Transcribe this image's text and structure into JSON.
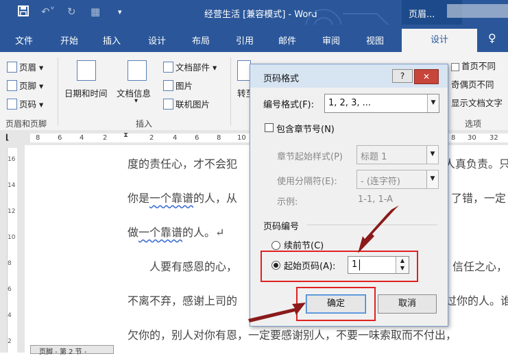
{
  "window": {
    "title": "经营生活 [兼容模式] - Word",
    "context_label": "页眉..."
  },
  "tabs": [
    "文件",
    "开始",
    "插入",
    "设计",
    "布局",
    "引用",
    "邮件",
    "审阅",
    "视图",
    "设计"
  ],
  "ribbon": {
    "header": "页眉",
    "footer": "页脚",
    "page_number": "页码",
    "group_header_footer": "页眉和页脚",
    "date_time": "日期和时间",
    "doc_info": "文档信息",
    "doc_parts": "文档部件",
    "picture": "图片",
    "online_picture": "联机图片",
    "group_insert": "插入",
    "goto": "转至",
    "first_page_diff": "首页不同",
    "odd_even_diff": "奇偶页不同",
    "show_doc_text": "显示文档文字",
    "group_options": "选项"
  },
  "ruler_ticks": [
    "8",
    "6",
    "4",
    "2",
    "2",
    "4",
    "6",
    "8",
    "10",
    "8",
    "30",
    "32"
  ],
  "vruler_ticks": [
    "16",
    "14",
    "12",
    "10",
    "8",
    "6",
    "4",
    "2"
  ],
  "document": {
    "line1a": "度的责任心，才不会犯",
    "line1b": "人真负责。只",
    "line2a": "你是",
    "line2u": "一个靠谱",
    "line2b": "的人，从",
    "line2c": "了错，一定",
    "line3a": "做",
    "line3u": "一个靠谱",
    "line3b": "的人。↵",
    "line4a": "人要有感恩的心，",
    "line4b": "信任之心，",
    "line5a": "不离不弃，感谢上司的",
    "line5b": "过你的人。谁",
    "line6": "欠你的，别人对你有恩，一定要感谢别人，不要一味索取而不付出，"
  },
  "status": {
    "footer_label": "页脚 - 第 2 节 -"
  },
  "dialog": {
    "title": "页码格式",
    "help": "?",
    "number_format_label": "编号格式(F):",
    "number_format_value": "1, 2, 3, ...",
    "include_chapter": "包含章节号(N)",
    "chapter_style_label": "章节起始样式(P)",
    "chapter_style_value": "标题 1",
    "separator_label": "使用分隔符(E):",
    "separator_value": "-  (连字符)",
    "example_label": "示例:",
    "example_value": "1-1, 1-A",
    "numbering_group": "页码编号",
    "continue_label": "续前节(C)",
    "start_at_label": "起始页码(A):",
    "start_at_value": "1",
    "ok": "确定",
    "cancel": "取消"
  },
  "colors": {
    "word_blue": "#2b579a",
    "highlight_red": "#e02020",
    "arrow": "#8b1a1a"
  }
}
